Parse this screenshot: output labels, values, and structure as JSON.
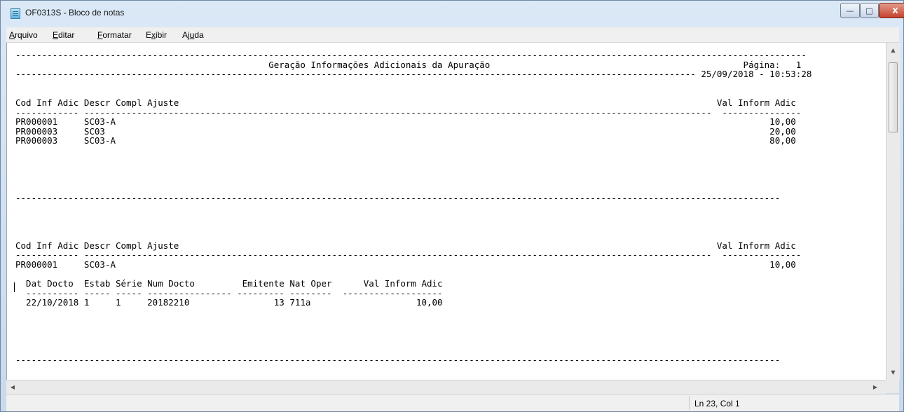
{
  "window": {
    "title": "OF0313S - Bloco de notas",
    "controls": {
      "minimize": "—",
      "maximize": "□",
      "close": "X"
    }
  },
  "menu": {
    "items": [
      {
        "label": "Arquivo",
        "accel": "A"
      },
      {
        "label": "Editar",
        "accel": "E"
      },
      {
        "label": "Formatar",
        "accel": "F"
      },
      {
        "label": "Exibir",
        "accel": "x"
      },
      {
        "label": "Ajuda",
        "accel": "u"
      }
    ]
  },
  "document": {
    "content": "------------------------------------------------------------------------------------------------------------------------------------------------------\n                                                Geração Informações Adicionais da Apuração                                                Página:   1\n--------------------------------------------------------------------------------------------------------------------------------- 25/09/2018 - 10:53:28\n\n\nCod Inf Adic Descr Compl Ajuste                                                                                                      Val Inform Adic\n------------ -----------------------------------------------------------------------------------------------------------------------  ---------------\nPR000001     SC03-A                                                                                                                            10,00\nPR000003     SC03                                                                                                                              20,00\nPR000003     SC03-A                                                                                                                            80,00\n\n\n\n\n\n-------------------------------------------------------------------------------------------------------------------------------------------------\n\n\n\n\nCod Inf Adic Descr Compl Ajuste                                                                                                      Val Inform Adic\n------------ -----------------------------------------------------------------------------------------------------------------------  ---------------\nPR000001     SC03-A                                                                                                                            10,00\n\n  Dat Docto  Estab Série Num Docto         Emitente Nat Oper      Val Inform Adic\n  ---------- ----- ----- ---------------- --------- --------  -------------------\n  22/10/2018 1     1     20182210                13 711a                    10,00\n\n\n\n\n\n-------------------------------------------------------------------------------------------------------------------------------------------------"
  },
  "status": {
    "position": "Ln 23, Col 1"
  }
}
